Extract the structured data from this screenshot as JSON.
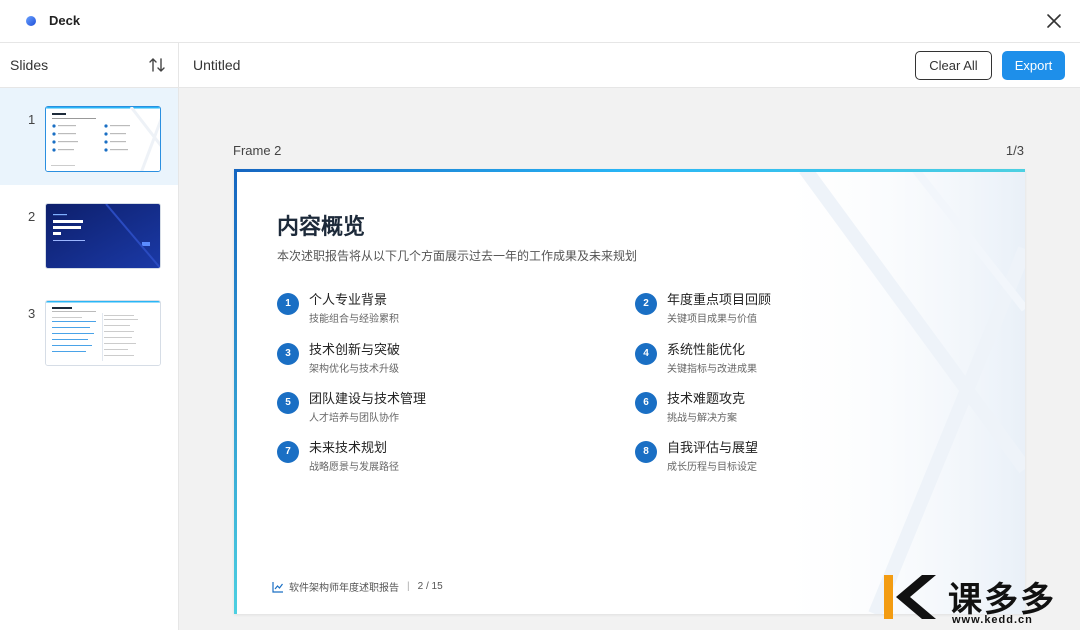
{
  "app": {
    "title": "Deck",
    "logo_icon": "app-logo-icon",
    "close_icon": "close-icon"
  },
  "sidebar": {
    "title": "Slides",
    "sort_icon": "sort-arrows-icon",
    "items": [
      {
        "number": "1",
        "active": true,
        "thumb_title": "内容概览"
      },
      {
        "number": "2",
        "active": false,
        "thumb_title": "软件架构师年度述职报告"
      },
      {
        "number": "3",
        "active": false,
        "thumb_title": "个人专业背景"
      }
    ]
  },
  "toolbar": {
    "doc_title": "Untitled",
    "clear_label": "Clear All",
    "export_label": "Export"
  },
  "canvas": {
    "frame_label": "Frame 2",
    "frame_count": "1/3"
  },
  "slide": {
    "heading": "内容概览",
    "subtitle": "本次述职报告将从以下几个方面展示过去一年的工作成果及未来规划",
    "items": [
      {
        "num": "1",
        "title": "个人专业背景",
        "desc": "技能组合与经验累积"
      },
      {
        "num": "2",
        "title": "年度重点项目回顾",
        "desc": "关键项目成果与价值"
      },
      {
        "num": "3",
        "title": "技术创新与突破",
        "desc": "架构优化与技术升级"
      },
      {
        "num": "4",
        "title": "系统性能优化",
        "desc": "关键指标与改进成果"
      },
      {
        "num": "5",
        "title": "团队建设与技术管理",
        "desc": "人才培养与团队协作"
      },
      {
        "num": "6",
        "title": "技术难题攻克",
        "desc": "挑战与解决方案"
      },
      {
        "num": "7",
        "title": "未来技术规划",
        "desc": "战略愿景与发展路径"
      },
      {
        "num": "8",
        "title": "自我评估与展望",
        "desc": "成长历程与目标设定"
      }
    ],
    "footer_text": "软件架构师年度述职报告",
    "footer_page": "2 / 15",
    "footer_icon": "chart-line-icon"
  },
  "watermark": {
    "text": "课多多",
    "url": "www.kedd.cn"
  },
  "colors": {
    "accent": "#1e8fea",
    "number_badge": "#1a6fc4",
    "active_item_bg": "#eaf4fc"
  }
}
